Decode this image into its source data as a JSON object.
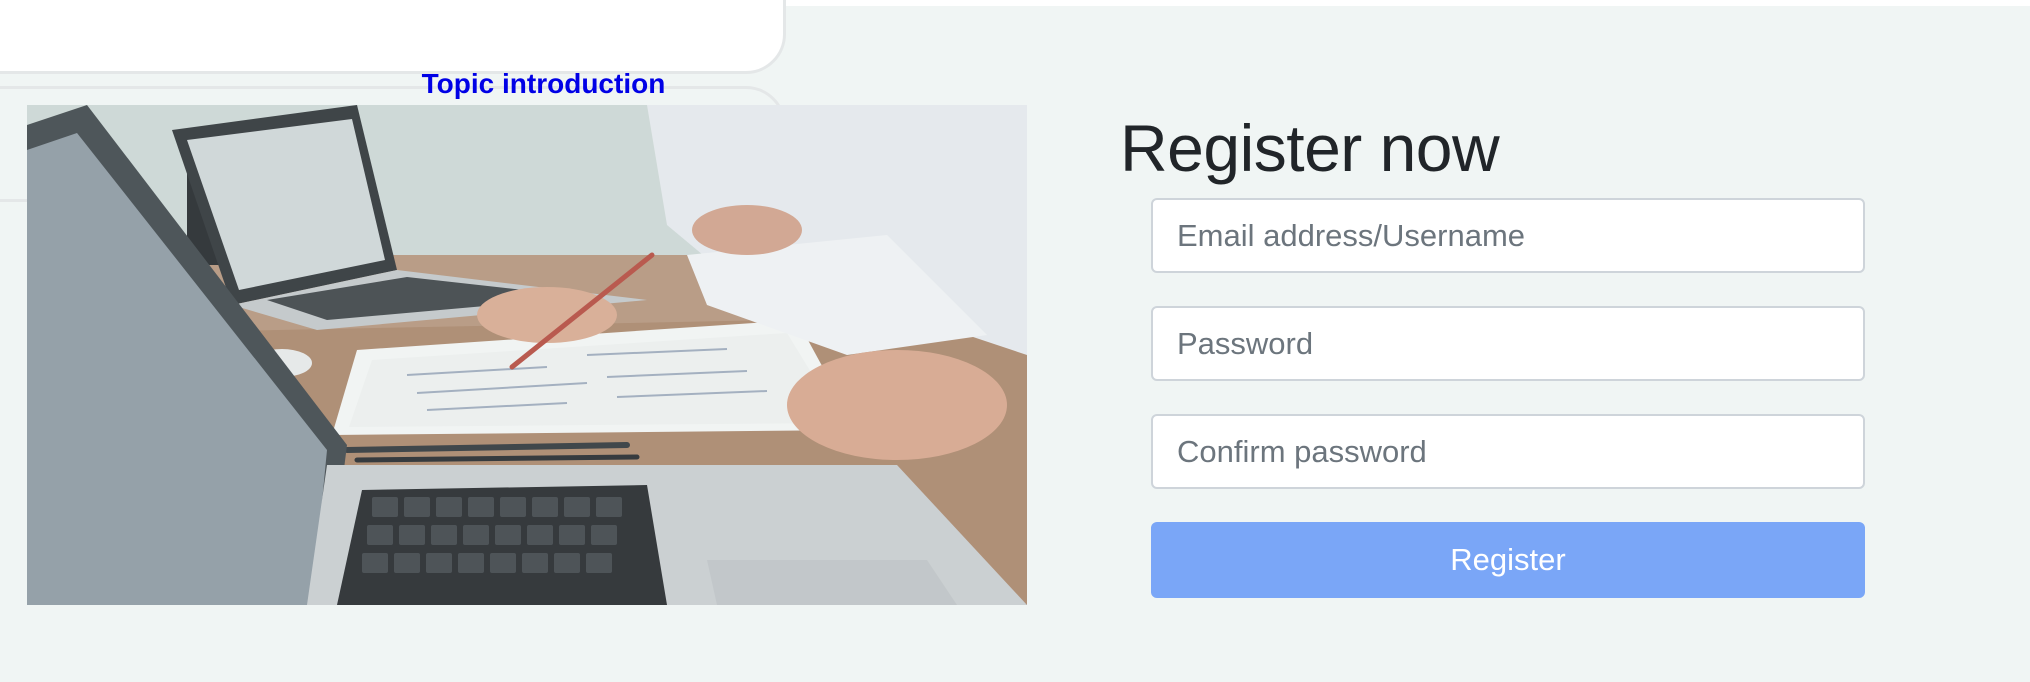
{
  "intro": {
    "title": "Topic introduction"
  },
  "register": {
    "heading": "Register now",
    "email_placeholder": "Email address/Username",
    "password_placeholder": "Password",
    "confirm_placeholder": "Confirm password",
    "submit_label": "Register"
  },
  "colors": {
    "page_bg": "#f0f5f4",
    "title_link": "#0000e6",
    "button_bg": "#7aa6f7",
    "heading": "#212529"
  },
  "hero_image": {
    "subject": "laptops-and-documents-on-desk"
  }
}
